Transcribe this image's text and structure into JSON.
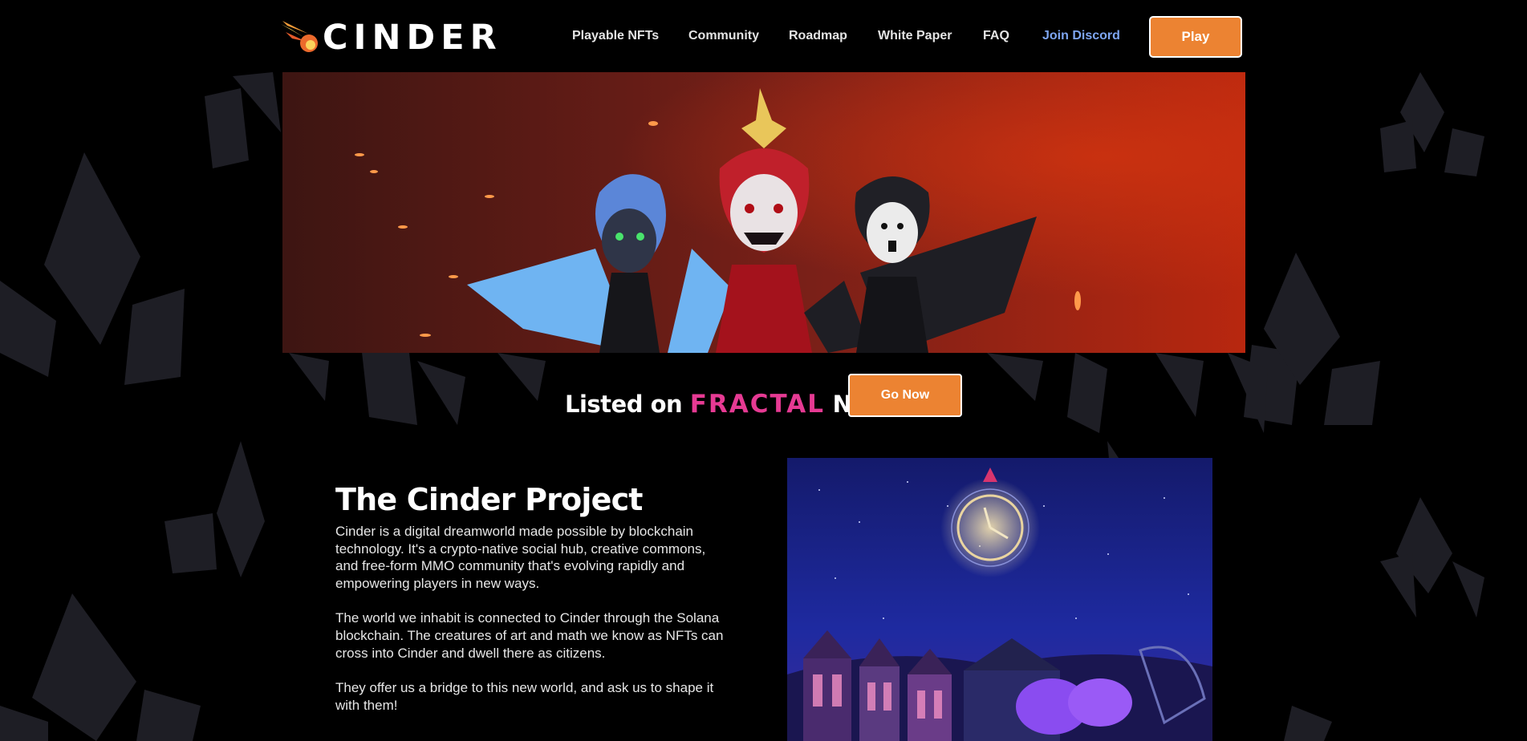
{
  "brand": {
    "name": "CINDER"
  },
  "nav": {
    "links": [
      {
        "label": "Playable NFTs"
      },
      {
        "label": "Community"
      },
      {
        "label": "Roadmap"
      },
      {
        "label": "White Paper"
      },
      {
        "label": "FAQ"
      },
      {
        "label": "Join Discord"
      }
    ],
    "play_label": "Play"
  },
  "listing": {
    "prefix": "Listed on",
    "platform": "FRACTAL",
    "suffix": "NOW!",
    "button_label": "Go Now"
  },
  "project": {
    "title": "The Cinder Project",
    "paragraphs": [
      "Cinder is a digital dreamworld made possible by blockchain technology. It's a crypto-native social hub, creative commons, and free-form MMO community that's evolving rapidly and empowering players in new ways.",
      "The world we inhabit is connected to Cinder through the Solana blockchain. The creatures of art and math we know as NFTs can cross into Cinder and dwell there as citizens.",
      "They offer us a bridge to this new world, and ask us to shape it with them!"
    ]
  },
  "colors": {
    "accent": "#ec8332",
    "fractal": "#e63a93",
    "discord_link": "#7ea6f2",
    "background": "#000000"
  }
}
